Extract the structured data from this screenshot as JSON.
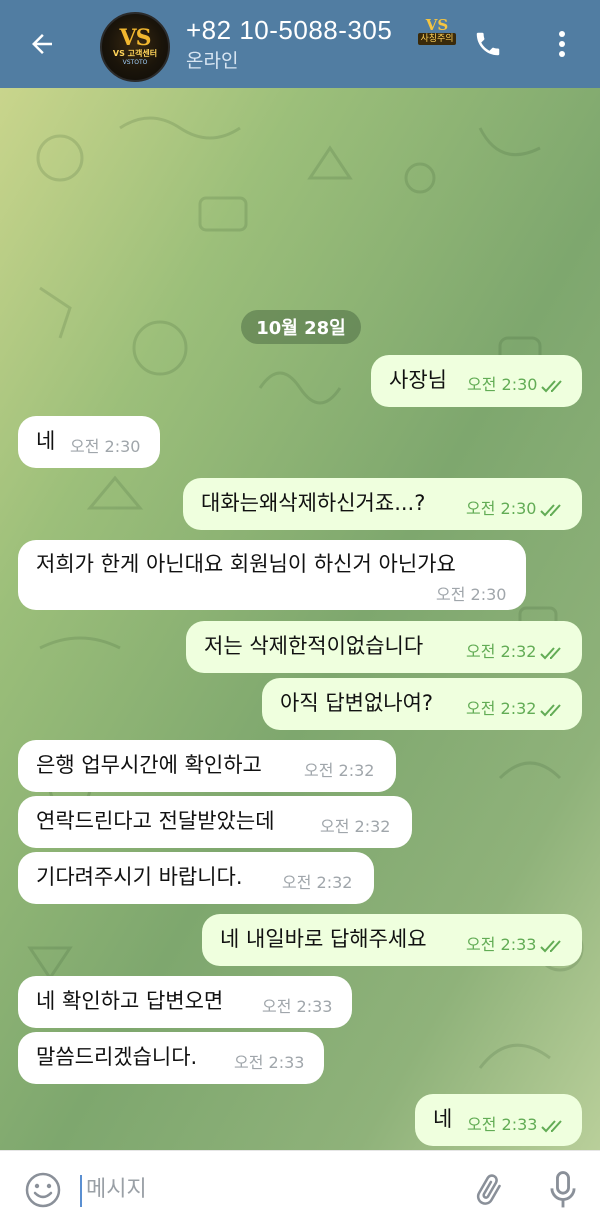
{
  "header": {
    "title": "+82 10-5088-305",
    "status": "온라인",
    "avatar": {
      "logo_text": "VS",
      "subtitle": "VS 고객센터",
      "tagline": "VSTOTO"
    },
    "badge": {
      "logo_text": "VS",
      "label": "사칭주의"
    },
    "icons": {
      "back": "arrow-left-icon",
      "call": "phone-icon",
      "menu": "more-vertical-icon"
    }
  },
  "chat": {
    "date": "10월 28일",
    "messages": [
      {
        "dir": "out",
        "text": "사장님",
        "time": "오전 2:30",
        "read": true
      },
      {
        "dir": "in",
        "text": "네",
        "time": "오전 2:30"
      },
      {
        "dir": "out",
        "text": "대화는왜삭제하신거죠...?",
        "time": "오전 2:30",
        "read": true
      },
      {
        "dir": "in",
        "text": "저희가 한게 아닌대요 회원님이 하신거 아닌가요",
        "time": "오전 2:30"
      },
      {
        "dir": "out",
        "text": "저는 삭제한적이없습니다",
        "time": "오전 2:32",
        "read": true
      },
      {
        "dir": "out",
        "text": "아직 답변없나여?",
        "time": "오전 2:32",
        "read": true
      },
      {
        "dir": "in",
        "text": "은행 업무시간에 확인하고",
        "time": "오전 2:32"
      },
      {
        "dir": "in",
        "text": "연락드린다고 전달받았는데",
        "time": "오전 2:32"
      },
      {
        "dir": "in",
        "text": "기다려주시기 바랍니다.",
        "time": "오전 2:32"
      },
      {
        "dir": "out",
        "text": "네 내일바로 답해주세요",
        "time": "오전 2:33",
        "read": true
      },
      {
        "dir": "in",
        "text": "네 확인하고 답변오면",
        "time": "오전 2:33"
      },
      {
        "dir": "in",
        "text": "말씀드리겠습니다.",
        "time": "오전 2:33"
      },
      {
        "dir": "out",
        "text": "네",
        "time": "오전 2:33",
        "read": true
      }
    ]
  },
  "input": {
    "placeholder": "메시지",
    "value": "",
    "icons": {
      "emoji": "emoji-icon",
      "attach": "paperclip-icon",
      "mic": "microphone-icon"
    }
  },
  "colors": {
    "header_bg": "#517da2",
    "incoming_bubble": "#ffffff",
    "outgoing_bubble": "#efffde",
    "outgoing_meta": "#62ac55",
    "incoming_meta": "#a0a6ab"
  }
}
